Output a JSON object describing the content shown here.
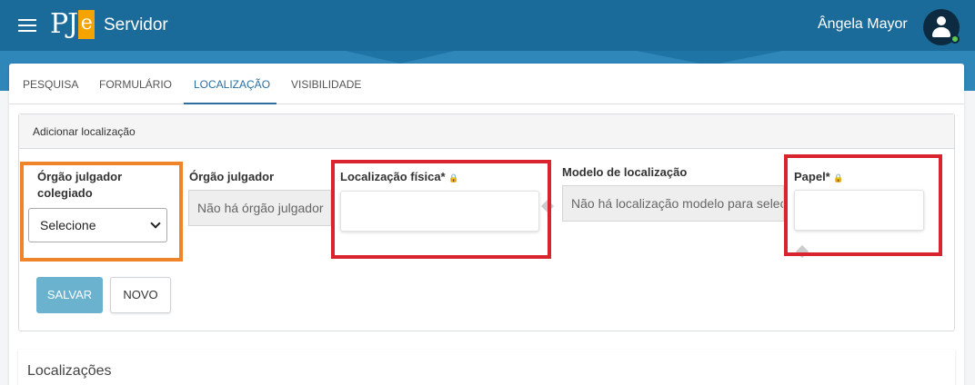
{
  "header": {
    "app_name_part1": "PJ",
    "app_name_part2": "e",
    "title": "Servidor",
    "user_name": "Ângela Mayor",
    "colors": {
      "bar": "#1b6b9a",
      "band": "#2f86b9",
      "logo_accent": "#f5a300"
    }
  },
  "tabs": [
    {
      "label": "PESQUISA"
    },
    {
      "label": "FORMULÁRIO"
    },
    {
      "label": "LOCALIZAÇÃO",
      "active": true
    },
    {
      "label": "VISIBILIDADE"
    }
  ],
  "panel": {
    "title": "Adicionar localização",
    "fields": {
      "orgao_colegiado": {
        "label": "Órgão julgador colegiado",
        "value": "Selecione"
      },
      "orgao_julgador": {
        "label": "Órgão julgador",
        "value": "Não há órgão julgador"
      },
      "localizacao_fisica": {
        "label": "Localização física*",
        "value": ""
      },
      "modelo_localizacao": {
        "label": "Modelo de localização",
        "value": "Não há localização modelo para selec"
      },
      "papel": {
        "label": "Papel*",
        "value": ""
      }
    },
    "buttons": {
      "save": "SALVAR",
      "new": "NOVO"
    }
  },
  "list_section": {
    "title": "Localizações"
  },
  "highlight_colors": {
    "orange": "#f0842a",
    "red": "#d9242f"
  }
}
